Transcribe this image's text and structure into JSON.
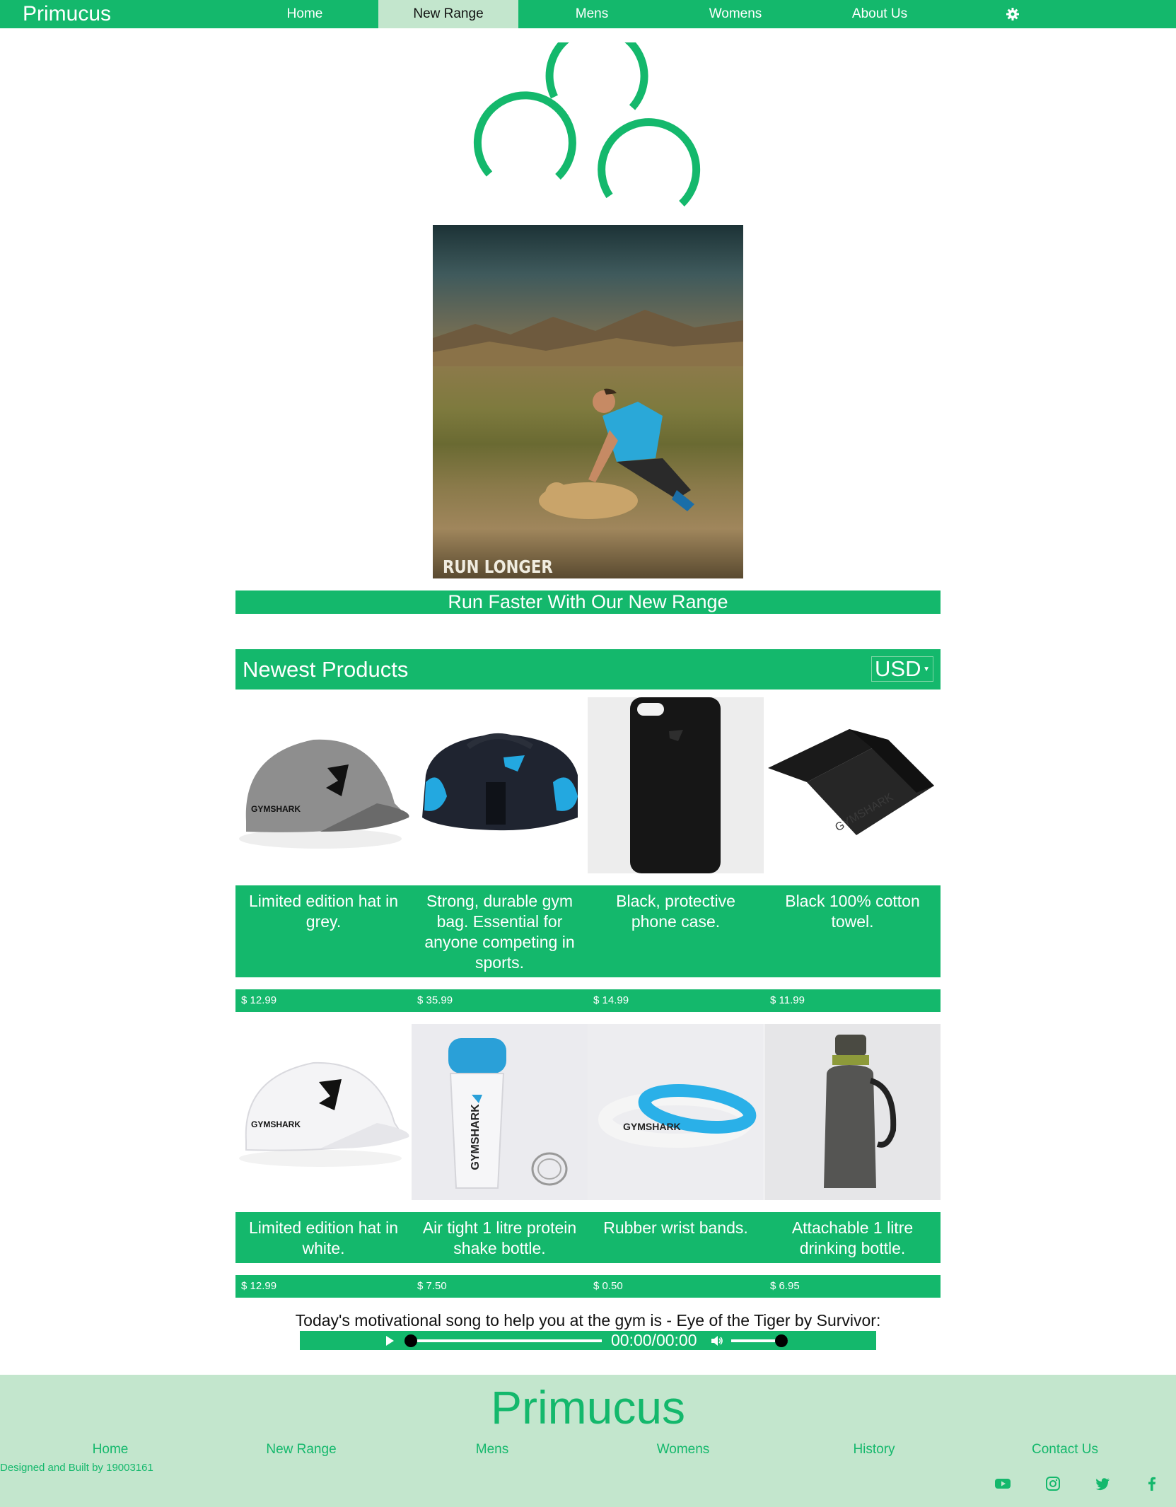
{
  "brand": "Primucus",
  "nav": {
    "items": [
      {
        "label": "Home"
      },
      {
        "label": "New Range"
      },
      {
        "label": "Mens"
      },
      {
        "label": "Womens"
      },
      {
        "label": "About Us"
      }
    ],
    "settings_icon": "gear-icon"
  },
  "hero": {
    "caption": "RUN LONGER",
    "banner": "Run Faster With Our New Range"
  },
  "products_section": {
    "title": "Newest Products",
    "currency": "USD"
  },
  "products": [
    {
      "description": "Limited edition hat in grey.",
      "price": "$ 12.99"
    },
    {
      "description": "Strong, durable gym bag. Essential for anyone competing in sports.",
      "price": "$ 35.99"
    },
    {
      "description": "Black, protective phone case.",
      "price": "$ 14.99"
    },
    {
      "description": "Black 100% cotton towel.",
      "price": "$ 11.99"
    },
    {
      "description": "Limited edition hat in white.",
      "price": "$ 12.99"
    },
    {
      "description": "Air tight 1 litre protein shake bottle.",
      "price": "$ 7.50"
    },
    {
      "description": "Rubber wrist bands.",
      "price": "$ 0.50"
    },
    {
      "description": "Attachable 1 litre drinking bottle.",
      "price": "$ 6.95"
    }
  ],
  "product_image_text": {
    "brand_mark": "GYMSHARK"
  },
  "song": {
    "text": "Today's motivational song to help you at the gym is - Eye of the Tiger by Survivor:",
    "time": "00:00/00:00"
  },
  "footer": {
    "brand": "Primucus",
    "links": [
      {
        "label": "Home"
      },
      {
        "label": "New Range"
      },
      {
        "label": "Mens"
      },
      {
        "label": "Womens"
      },
      {
        "label": "History"
      },
      {
        "label": "Contact Us"
      }
    ],
    "credit": "Designed and Built by 19003161",
    "social_icons": [
      "youtube-icon",
      "instagram-icon",
      "twitter-icon",
      "facebook-icon"
    ]
  },
  "colors": {
    "accent": "#14b86c",
    "accent_light": "#c3e6cd"
  }
}
